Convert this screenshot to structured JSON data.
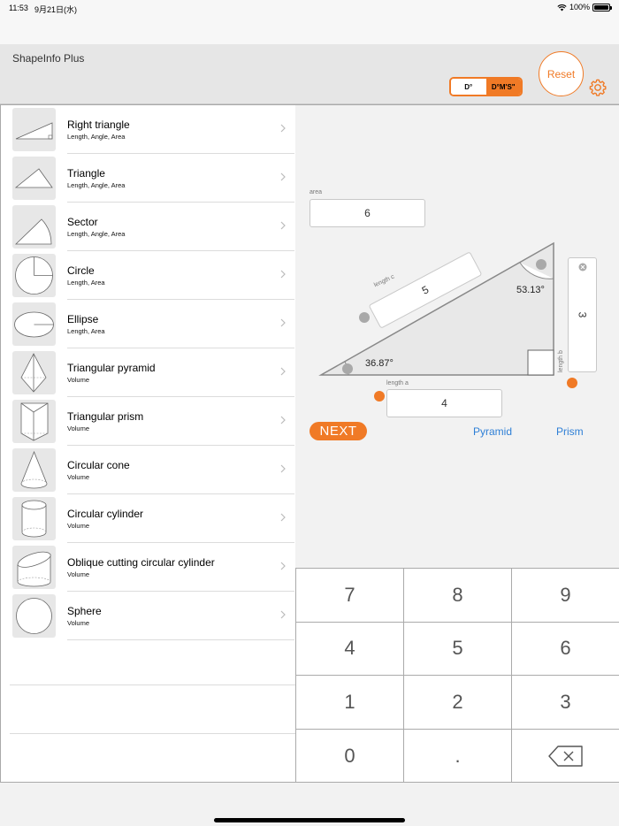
{
  "status": {
    "time": "11:53",
    "date": "9月21日(水)",
    "battery": "100%"
  },
  "header": {
    "title": "ShapeInfo Plus",
    "unit_options": [
      "D°",
      "D°M'S\""
    ],
    "reset_label": "Reset"
  },
  "shapes": [
    {
      "name": "Right triangle",
      "sub": "Length, Angle, Area",
      "icon": "right-triangle-icon"
    },
    {
      "name": "Triangle",
      "sub": "Length, Angle, Area",
      "icon": "triangle-icon"
    },
    {
      "name": "Sector",
      "sub": "Length, Angle, Area",
      "icon": "sector-icon"
    },
    {
      "name": "Circle",
      "sub": "Length, Area",
      "icon": "circle-icon"
    },
    {
      "name": "Ellipse",
      "sub": "Length, Area",
      "icon": "ellipse-icon"
    },
    {
      "name": "Triangular pyramid",
      "sub": "Volume",
      "icon": "triangular-pyramid-icon"
    },
    {
      "name": "Triangular prism",
      "sub": "Volume",
      "icon": "triangular-prism-icon"
    },
    {
      "name": "Circular cone",
      "sub": "Volume",
      "icon": "circular-cone-icon"
    },
    {
      "name": "Circular cylinder",
      "sub": "Volume",
      "icon": "circular-cylinder-icon"
    },
    {
      "name": "Oblique cutting circular cylinder",
      "sub": "Volume",
      "icon": "oblique-cylinder-icon"
    },
    {
      "name": "Sphere",
      "sub": "Volume",
      "icon": "sphere-icon"
    }
  ],
  "calc": {
    "area_label": "area",
    "area_value": "6",
    "length_c_label": "length c",
    "length_c_value": "5",
    "length_b_label": "length b",
    "length_b_value": "3",
    "length_a_label": "length a",
    "length_a_value": "4",
    "angle_left": "36.87°",
    "angle_top": "53.13°",
    "next_label": "NEXT",
    "pyramid_label": "Pyramid",
    "prism_label": "Prism"
  },
  "keypad": {
    "keys": [
      "7",
      "8",
      "9",
      "4",
      "5",
      "6",
      "1",
      "2",
      "3",
      "0",
      "."
    ]
  },
  "colors": {
    "accent": "#f07a26",
    "link": "#2e7fd6"
  }
}
